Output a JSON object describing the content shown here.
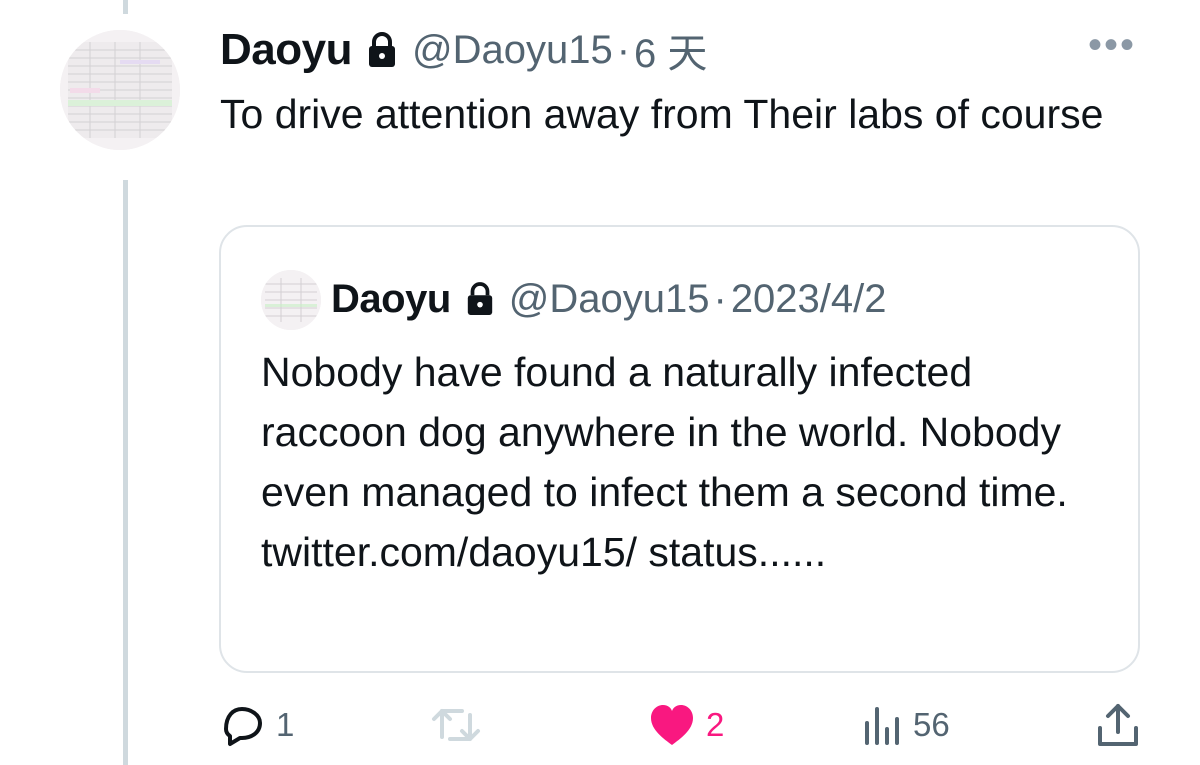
{
  "tweet": {
    "author_name": "Daoyu",
    "author_handle": "@Daoyu15",
    "separator": "·",
    "time": "6 天",
    "more_label": "•••",
    "text": "To drive attention away from Their labs of course"
  },
  "quoted_tweet": {
    "author_name": "Daoyu",
    "author_handle": "@Daoyu15",
    "separator": "·",
    "time": "2023/4/2",
    "text": "Nobody have found a naturally infected raccoon dog anywhere in the world. Nobody even managed to infect them a second time. twitter.com/daoyu15/ status......"
  },
  "actions": {
    "replies": "1",
    "retweets": "",
    "likes": "2",
    "views": "56"
  },
  "colors": {
    "text": "#0f1419",
    "secondary": "#536471",
    "like": "#f91880",
    "border": "#dfe4e8",
    "thread_line": "#cfd9de"
  },
  "icons": [
    "lock-icon",
    "more-icon",
    "reply-icon",
    "retweet-icon",
    "heart-icon",
    "views-icon",
    "share-icon"
  ]
}
